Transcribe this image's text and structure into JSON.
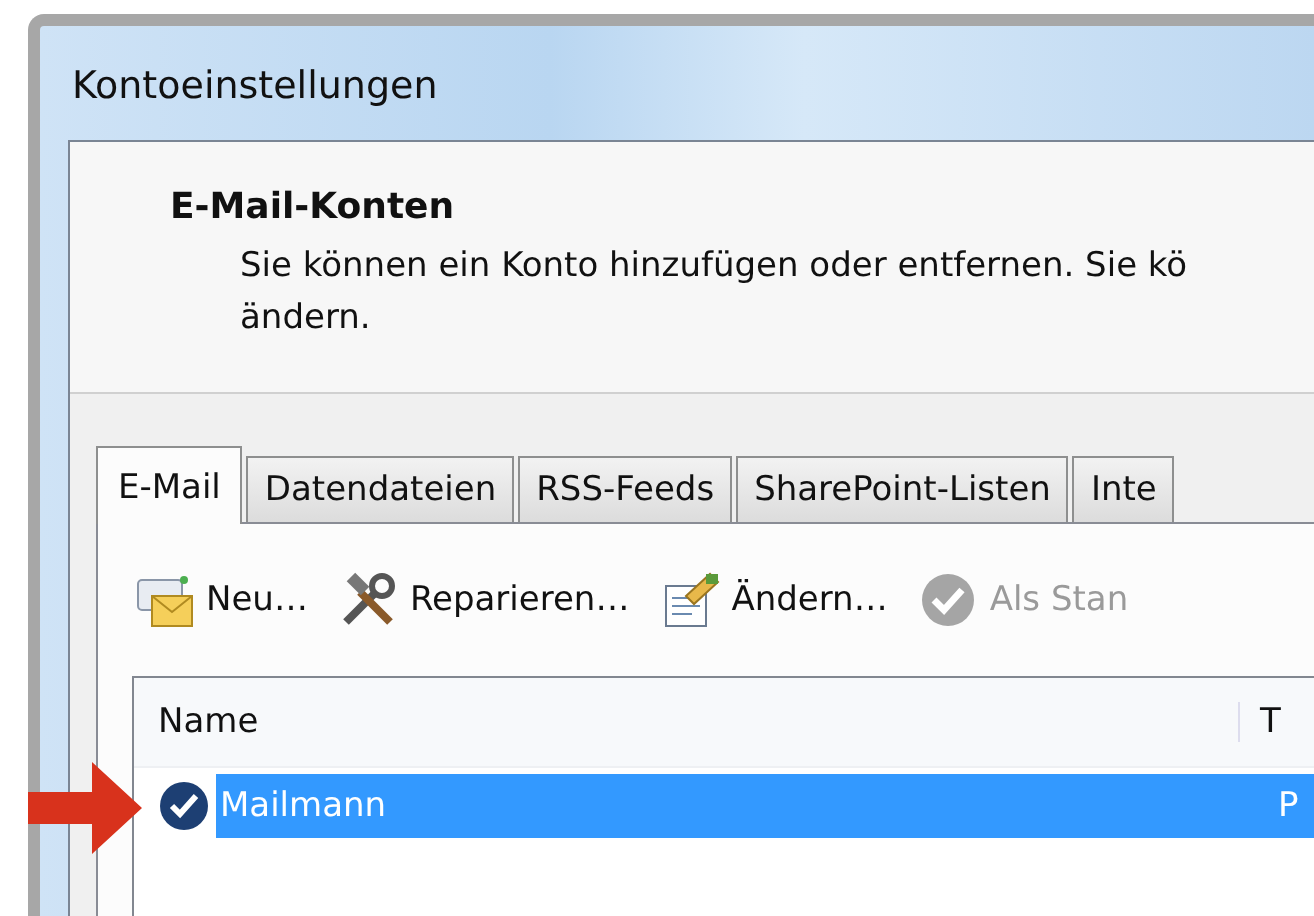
{
  "window": {
    "title": "Kontoeinstellungen"
  },
  "header": {
    "title": "E-Mail-Konten",
    "description_lines": [
      "Sie können ein Konto hinzufügen oder entfernen. Sie kö",
      "ändern."
    ]
  },
  "tabs": [
    {
      "label": "E-Mail",
      "selected": true
    },
    {
      "label": "Datendateien",
      "selected": false
    },
    {
      "label": "RSS-Feeds",
      "selected": false
    },
    {
      "label": "SharePoint-Listen",
      "selected": false
    },
    {
      "label": "Inte",
      "selected": false
    }
  ],
  "toolbar": [
    {
      "kind": "new",
      "label": "Neu…",
      "disabled": false
    },
    {
      "kind": "repair",
      "label": "Reparieren…",
      "disabled": false
    },
    {
      "kind": "change",
      "label": "Ändern…",
      "disabled": false
    },
    {
      "kind": "default",
      "label": "Als Stan",
      "disabled": true
    }
  ],
  "table": {
    "columns": [
      "Name",
      "T"
    ],
    "rows": [
      {
        "cells": [
          "Mailmann",
          "P"
        ],
        "selected": true,
        "default": true
      }
    ]
  },
  "annotation": {
    "kind": "arrow"
  }
}
